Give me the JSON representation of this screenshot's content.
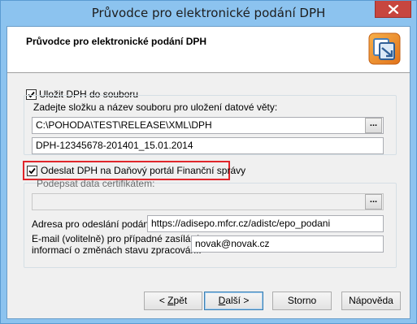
{
  "window": {
    "title": "Průvodce pro elektronické podání DPH"
  },
  "header": {
    "title": "Průvodce pro elektronické podání DPH",
    "logo_icon": "pohoda-logo-icon"
  },
  "save_section": {
    "checkbox_label": "Uložit DPH do souboru",
    "checked": true,
    "group_caption": "Zadejte složku a název souboru pro uložení datové věty:",
    "folder_value": "C:\\POHODA\\TEST\\RELEASE\\XML\\DPH",
    "browse_label": "...",
    "filename_value": "DPH-12345678-201401_15.01.2014"
  },
  "send_section": {
    "checkbox_label": "Odeslat DPH na Daňový portál Finanční správy",
    "checked": true,
    "highlight_color": "#e0262b",
    "cert_caption": "Podepsat data certifikátem:",
    "cert_value": "",
    "browse_label": "...",
    "address_label": "Adresa pro odeslání podání:",
    "address_value": "https://adisepo.mfcr.cz/adistc/epo_podani",
    "email_label_line1": "E-mail (volitelně) pro případné zasílání",
    "email_label_line2": "informací o změnách stavu zpracování:",
    "email_value": "novak@novak.cz"
  },
  "buttons": {
    "back_prefix": "< ",
    "back_mnemonic": "Z",
    "back_rest": "pět",
    "next_mnemonic": "D",
    "next_rest": "alší >",
    "cancel": "Storno",
    "help": "Nápověda"
  },
  "colors": {
    "title_bar": "#8cc3ef",
    "close_button": "#c7463f",
    "dialog_bg": "#f0f0f0"
  }
}
